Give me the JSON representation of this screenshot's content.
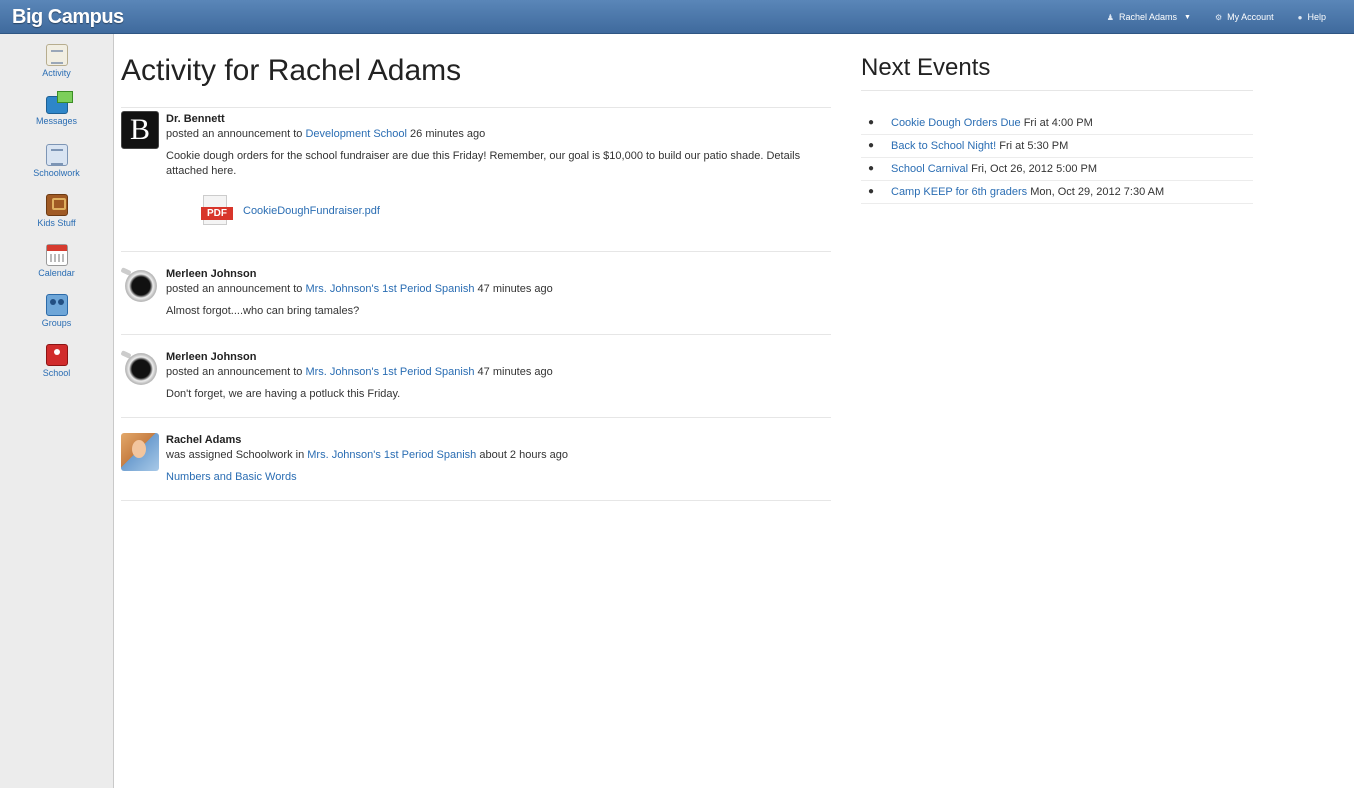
{
  "app": {
    "name": "Big Campus"
  },
  "topnav": {
    "user": "Rachel Adams",
    "account": "My Account",
    "help": "Help"
  },
  "sidebar": {
    "items": [
      {
        "label": "Activity",
        "icon": "activity-icon"
      },
      {
        "label": "Messages",
        "icon": "messages-icon"
      },
      {
        "label": "Schoolwork",
        "icon": "schoolwork-icon"
      },
      {
        "label": "Kids Stuff",
        "icon": "kids-stuff-icon"
      },
      {
        "label": "Calendar",
        "icon": "calendar-icon"
      },
      {
        "label": "Groups",
        "icon": "groups-icon"
      },
      {
        "label": "School",
        "icon": "school-icon"
      }
    ]
  },
  "main": {
    "title": "Activity for Rachel Adams",
    "feed": [
      {
        "author": "Dr. Bennett",
        "action": "posted an announcement to",
        "target": "Development School",
        "time": "26 minutes ago",
        "body": "Cookie dough orders for the school fundraiser are due this Friday! Remember, our goal is $10,000 to build our patio shade. Details attached here.",
        "attachment": "CookieDoughFundraiser.pdf",
        "attachment_type": "PDF"
      },
      {
        "author": "Merleen Johnson",
        "action": "posted an announcement to",
        "target": "Mrs. Johnson's 1st Period Spanish",
        "time": "47 minutes ago",
        "body": "Almost forgot....who can bring tamales?"
      },
      {
        "author": "Merleen Johnson",
        "action": "posted an announcement to",
        "target": "Mrs. Johnson's 1st Period Spanish",
        "time": "47 minutes ago",
        "body": "Don't forget, we are having a potluck this Friday."
      },
      {
        "author": "Rachel Adams",
        "action": "was assigned Schoolwork in",
        "target": "Mrs. Johnson's 1st Period Spanish",
        "time": "about 2 hours ago",
        "link": "Numbers and Basic Words"
      }
    ]
  },
  "events": {
    "title": "Next Events",
    "items": [
      {
        "name": "Cookie Dough Orders Due",
        "when": "Fri at 4:00 PM"
      },
      {
        "name": "Back to School Night!",
        "when": "Fri at 5:30 PM"
      },
      {
        "name": "School Carnival",
        "when": "Fri, Oct 26, 2012 5:00 PM"
      },
      {
        "name": "Camp KEEP for 6th graders",
        "when": "Mon, Oct 29, 2012 7:30 AM"
      }
    ]
  },
  "colors": {
    "topbar": "#4a76a8",
    "link": "#2a6db3",
    "sidebar_bg": "#ececec"
  }
}
